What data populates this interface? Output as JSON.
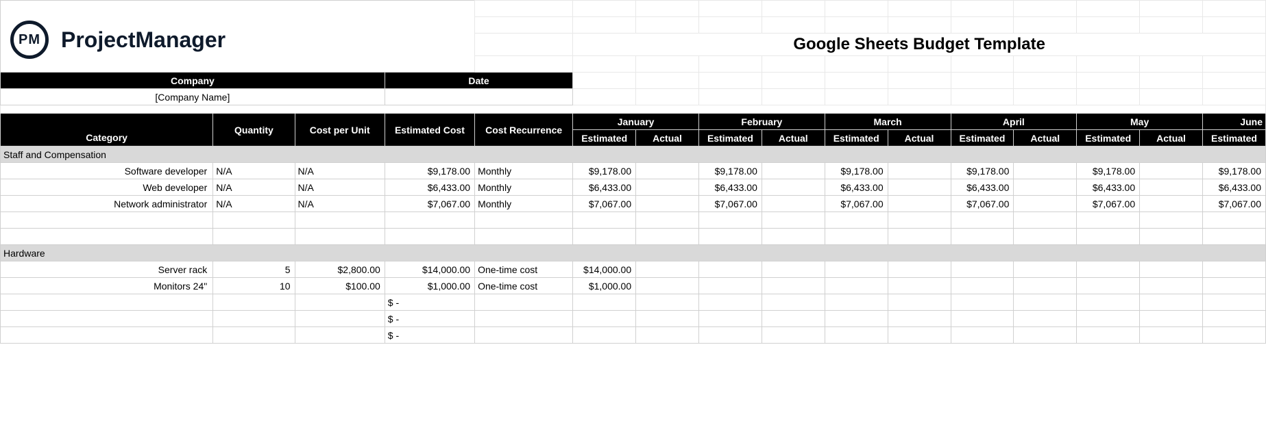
{
  "brand": {
    "logo_abbrev": "PM",
    "logo_text": "ProjectManager"
  },
  "title": "Google Sheets Budget Template",
  "meta_headers": {
    "company": "Company",
    "date": "Date"
  },
  "meta_values": {
    "company": "[Company Name]",
    "date": ""
  },
  "columns": {
    "category": "Category",
    "quantity": "Quantity",
    "cost_per_unit": "Cost per Unit",
    "estimated_cost": "Estimated Cost",
    "cost_recurrence": "Cost Recurrence",
    "estimated": "Estimated",
    "actual": "Actual"
  },
  "months": [
    "January",
    "February",
    "March",
    "April",
    "May",
    "June"
  ],
  "sections": [
    {
      "name": "Staff and Compensation",
      "rows": [
        {
          "category": "Software developer",
          "quantity": "N/A",
          "cost_per_unit": "N/A",
          "estimated_cost": "$9,178.00",
          "recurrence": "Monthly",
          "months": {
            "jan_est": "$9,178.00",
            "jan_act": "",
            "feb_est": "$9,178.00",
            "feb_act": "",
            "mar_est": "$9,178.00",
            "mar_act": "",
            "apr_est": "$9,178.00",
            "apr_act": "",
            "may_est": "$9,178.00",
            "may_act": "",
            "jun_est": "$9,178.00"
          }
        },
        {
          "category": "Web developer",
          "quantity": "N/A",
          "cost_per_unit": "N/A",
          "estimated_cost": "$6,433.00",
          "recurrence": "Monthly",
          "months": {
            "jan_est": "$6,433.00",
            "jan_act": "",
            "feb_est": "$6,433.00",
            "feb_act": "",
            "mar_est": "$6,433.00",
            "mar_act": "",
            "apr_est": "$6,433.00",
            "apr_act": "",
            "may_est": "$6,433.00",
            "may_act": "",
            "jun_est": "$6,433.00"
          }
        },
        {
          "category": "Network administrator",
          "quantity": "N/A",
          "cost_per_unit": "N/A",
          "estimated_cost": "$7,067.00",
          "recurrence": "Monthly",
          "months": {
            "jan_est": "$7,067.00",
            "jan_act": "",
            "feb_est": "$7,067.00",
            "feb_act": "",
            "mar_est": "$7,067.00",
            "mar_act": "",
            "apr_est": "$7,067.00",
            "apr_act": "",
            "may_est": "$7,067.00",
            "may_act": "",
            "jun_est": "$7,067.00"
          }
        },
        {
          "category": "",
          "quantity": "",
          "cost_per_unit": "",
          "estimated_cost": "",
          "recurrence": "",
          "months": {
            "jan_est": "",
            "jan_act": "",
            "feb_est": "",
            "feb_act": "",
            "mar_est": "",
            "mar_act": "",
            "apr_est": "",
            "apr_act": "",
            "may_est": "",
            "may_act": "",
            "jun_est": ""
          }
        },
        {
          "category": "",
          "quantity": "",
          "cost_per_unit": "",
          "estimated_cost": "",
          "recurrence": "",
          "months": {
            "jan_est": "",
            "jan_act": "",
            "feb_est": "",
            "feb_act": "",
            "mar_est": "",
            "mar_act": "",
            "apr_est": "",
            "apr_act": "",
            "may_est": "",
            "may_act": "",
            "jun_est": ""
          }
        }
      ]
    },
    {
      "name": "Hardware",
      "rows": [
        {
          "category": "Server rack",
          "quantity": "5",
          "cost_per_unit": "$2,800.00",
          "estimated_cost": "$14,000.00",
          "recurrence": "One-time cost",
          "months": {
            "jan_est": "$14,000.00",
            "jan_act": "",
            "feb_est": "",
            "feb_act": "",
            "mar_est": "",
            "mar_act": "",
            "apr_est": "",
            "apr_act": "",
            "may_est": "",
            "may_act": "",
            "jun_est": ""
          }
        },
        {
          "category": "Monitors 24\"",
          "quantity": "10",
          "cost_per_unit": "$100.00",
          "estimated_cost": "$1,000.00",
          "recurrence": "One-time cost",
          "months": {
            "jan_est": "$1,000.00",
            "jan_act": "",
            "feb_est": "",
            "feb_act": "",
            "mar_est": "",
            "mar_act": "",
            "apr_est": "",
            "apr_act": "",
            "may_est": "",
            "may_act": "",
            "jun_est": ""
          }
        },
        {
          "category": "",
          "quantity": "",
          "cost_per_unit": "",
          "estimated_cost": "$ -",
          "recurrence": "",
          "months": {
            "jan_est": "",
            "jan_act": "",
            "feb_est": "",
            "feb_act": "",
            "mar_est": "",
            "mar_act": "",
            "apr_est": "",
            "apr_act": "",
            "may_est": "",
            "may_act": "",
            "jun_est": ""
          }
        },
        {
          "category": "",
          "quantity": "",
          "cost_per_unit": "",
          "estimated_cost": "$ -",
          "recurrence": "",
          "months": {
            "jan_est": "",
            "jan_act": "",
            "feb_est": "",
            "feb_act": "",
            "mar_est": "",
            "mar_act": "",
            "apr_est": "",
            "apr_act": "",
            "may_est": "",
            "may_act": "",
            "jun_est": ""
          }
        },
        {
          "category": "",
          "quantity": "",
          "cost_per_unit": "",
          "estimated_cost": "$ -",
          "recurrence": "",
          "months": {
            "jan_est": "",
            "jan_act": "",
            "feb_est": "",
            "feb_act": "",
            "mar_est": "",
            "mar_act": "",
            "apr_est": "",
            "apr_act": "",
            "may_est": "",
            "may_act": "",
            "jun_est": ""
          }
        }
      ]
    }
  ]
}
